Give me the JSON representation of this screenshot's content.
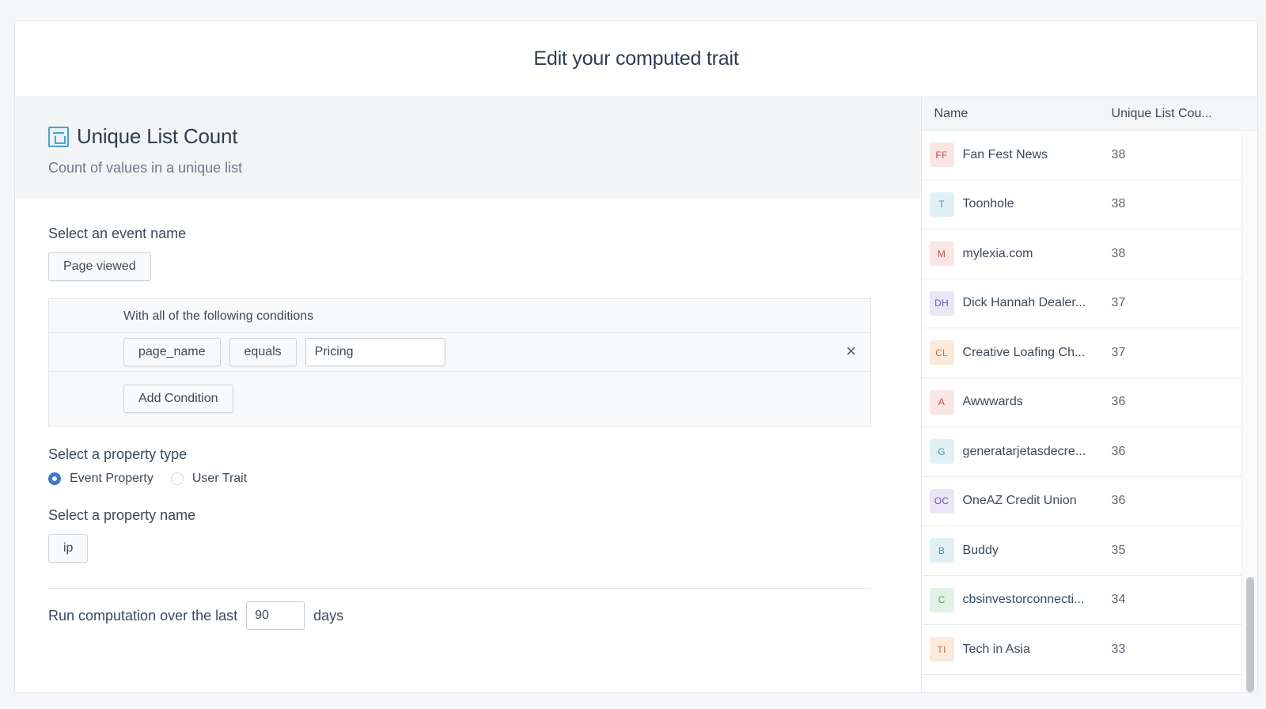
{
  "modal": {
    "title": "Edit your computed trait"
  },
  "trait": {
    "title": "Unique List Count",
    "description": "Count of values in a unique list",
    "icon": "trait-chart-icon"
  },
  "event": {
    "label": "Select an event name",
    "value": "Page viewed"
  },
  "conditions": {
    "header": "With all of the following conditions",
    "rows": [
      {
        "property": "page_name",
        "operator": "equals",
        "value": "Pricing"
      }
    ],
    "add_label": "Add Condition",
    "remove_icon": "close-icon"
  },
  "property_type": {
    "label": "Select a property type",
    "options": [
      {
        "label": "Event Property",
        "selected": true
      },
      {
        "label": "User Trait",
        "selected": false
      }
    ]
  },
  "property_name": {
    "label": "Select a property name",
    "value": "ip"
  },
  "computation": {
    "prefix": "Run computation over the last",
    "value": "90",
    "suffix": "days"
  },
  "table": {
    "columns": [
      "Name",
      "Unique List Cou..."
    ],
    "rows": [
      {
        "initials": "FF",
        "name": "Fan Fest News",
        "count": "38",
        "bg": "#fbe6e6",
        "fg": "#c0504d"
      },
      {
        "initials": "T",
        "name": "Toonhole",
        "count": "38",
        "bg": "#dff1f5",
        "fg": "#4a93a8"
      },
      {
        "initials": "M",
        "name": "mylexia.com",
        "count": "38",
        "bg": "#fbe6e6",
        "fg": "#c0504d"
      },
      {
        "initials": "DH",
        "name": "Dick Hannah Dealer...",
        "count": "37",
        "bg": "#ebe6f7",
        "fg": "#6b58a8"
      },
      {
        "initials": "CL",
        "name": "Creative Loafing Ch...",
        "count": "37",
        "bg": "#fbe9dc",
        "fg": "#c07a45"
      },
      {
        "initials": "A",
        "name": "Awwwards",
        "count": "36",
        "bg": "#fbe6e6",
        "fg": "#c0504d"
      },
      {
        "initials": "G",
        "name": "generatarjetasdecre...",
        "count": "36",
        "bg": "#dff1f5",
        "fg": "#4a93a8"
      },
      {
        "initials": "OC",
        "name": "OneAZ Credit Union",
        "count": "36",
        "bg": "#ebe6f7",
        "fg": "#6b58a8"
      },
      {
        "initials": "B",
        "name": "Buddy",
        "count": "35",
        "bg": "#dff1f5",
        "fg": "#4a93a8"
      },
      {
        "initials": "C",
        "name": "cbsinvestorconnecti...",
        "count": "34",
        "bg": "#e1f3e6",
        "fg": "#4f9a66"
      },
      {
        "initials": "TI",
        "name": "Tech in Asia",
        "count": "33",
        "bg": "#fbe9dc",
        "fg": "#c07a45"
      }
    ]
  }
}
